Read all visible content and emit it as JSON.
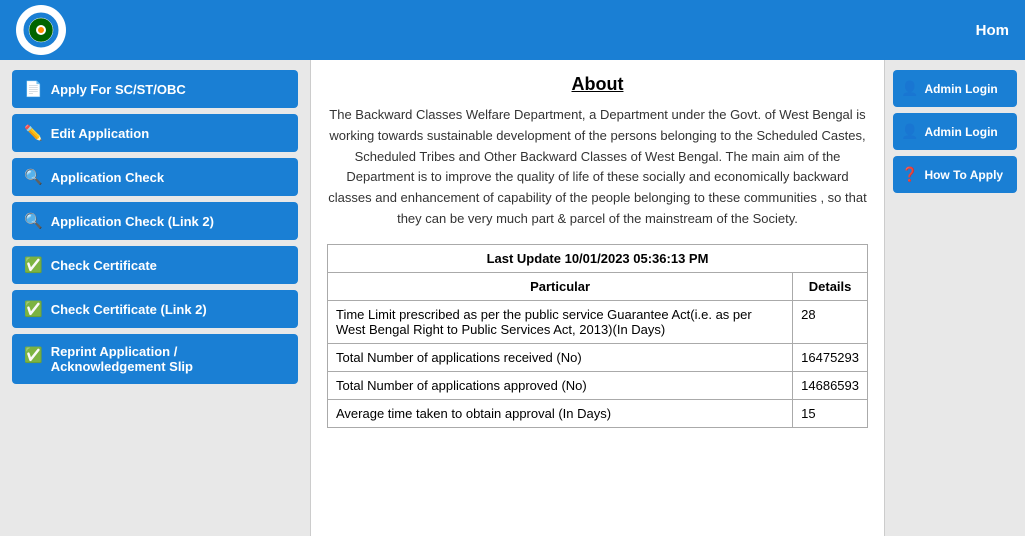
{
  "topnav": {
    "home_label": "Hom"
  },
  "sidebar": {
    "buttons": [
      {
        "id": "apply-sc-st-obc",
        "label": "Apply For SC/ST/OBC",
        "icon": "📄"
      },
      {
        "id": "edit-application",
        "label": "Edit Application",
        "icon": "✏️"
      },
      {
        "id": "application-check",
        "label": "Application Check",
        "icon": "🔍"
      },
      {
        "id": "application-check-link2",
        "label": "Application Check (Link 2)",
        "icon": "🔍"
      },
      {
        "id": "check-certificate",
        "label": "Check Certificate",
        "icon": "✅"
      },
      {
        "id": "check-certificate-link2",
        "label": "Check Certificate (Link 2)",
        "icon": "✅"
      },
      {
        "id": "reprint-application",
        "label": "Reprint Application / Acknowledgement Slip",
        "icon": "✅"
      }
    ]
  },
  "center": {
    "about_title": "About",
    "about_text": "The Backward Classes Welfare Department, a Department under the Govt. of West Bengal is working towards sustainable development of the persons belonging to the Scheduled Castes, Scheduled Tribes and Other Backward Classes of West Bengal. The main aim of the Department is to improve the quality of life of these socially and economically backward classes and enhancement of capability of the people belonging to these communities , so that they can be very much part & parcel of the mainstream of the Society.",
    "table": {
      "last_update": "Last Update 10/01/2023 05:36:13 PM",
      "col_particular": "Particular",
      "col_details": "Details",
      "rows": [
        {
          "particular": "Time Limit prescribed as per the public service Guarantee Act(i.e. as per West Bengal Right to Public Services Act, 2013)(In Days)",
          "details": "28"
        },
        {
          "particular": "Total Number of applications received (No)",
          "details": "16475293"
        },
        {
          "particular": "Total Number of applications approved (No)",
          "details": "14686593"
        },
        {
          "particular": "Average time taken to obtain approval (In Days)",
          "details": "15"
        }
      ]
    }
  },
  "right_sidebar": {
    "buttons": [
      {
        "id": "admin-login-1",
        "label": "Admin Login",
        "icon": "👤"
      },
      {
        "id": "admin-login-2",
        "label": "Admin Login",
        "icon": "👤"
      },
      {
        "id": "how-to-apply",
        "label": "How To Apply",
        "icon": "❓"
      }
    ]
  }
}
